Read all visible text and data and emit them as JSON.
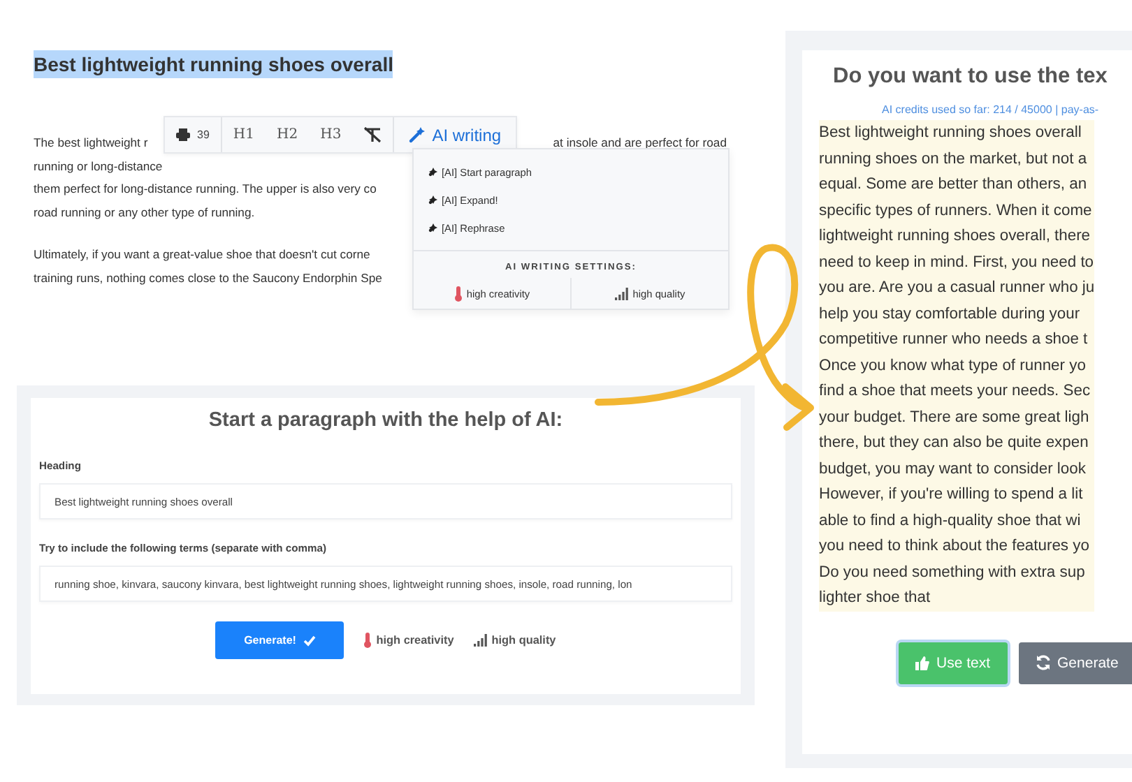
{
  "editor": {
    "heading": {
      "text": "Best lightweight running shoes overall",
      "selected": true
    },
    "paragraphs": [
      [
        {
          "left": "The best lightweight r",
          "right": "at insole and are perfect for road"
        },
        {
          "left": "running or long-distance"
        },
        {
          "left": "them perfect for long-distance running. The upper is also very co"
        },
        {
          "left": "road running or any other type of running."
        }
      ],
      [
        {
          "left": "Ultimately, if you want a great-value shoe that doesn't cut corne"
        },
        {
          "left": "training runs, nothing comes close to the Saucony Endorphin Spe"
        }
      ]
    ]
  },
  "toolbar": {
    "count": "39",
    "headings": [
      "H1",
      "H2",
      "H3"
    ],
    "ai_button": "AI writing"
  },
  "ai_menu": {
    "items": [
      "[AI] Start paragraph",
      "[AI] Expand!",
      "[AI] Rephrase"
    ],
    "settings_title": "AI WRITING SETTINGS:",
    "options": [
      {
        "label": "high creativity",
        "kind": "creativity"
      },
      {
        "label": "high quality",
        "kind": "quality"
      }
    ]
  },
  "dialog": {
    "title": "Start a paragraph with the help of AI:",
    "fields": [
      {
        "label": "Heading",
        "value": "Best lightweight running shoes overall"
      },
      {
        "label": "Try to include the following terms (separate with comma)",
        "value": "running shoe, kinvara, saucony kinvara, best lightweight running shoes, lightweight running shoes, insole, road running, lon"
      }
    ],
    "generate_button": "Generate!",
    "options": [
      {
        "label": "high creativity",
        "kind": "creativity"
      },
      {
        "label": "high quality",
        "kind": "quality"
      }
    ]
  },
  "result": {
    "title": "Do you want to use the tex",
    "credits": "AI credits used so far: 214 / 45000 | pay-as-",
    "lines": [
      "Best lightweight running shoes overall",
      "running shoes on the market, but not a",
      "equal. Some are better than others, an",
      "specific types of runners. When it come",
      "lightweight running shoes overall, there",
      "need to keep in mind. First, you need to",
      "you are. Are you a casual runner who ju",
      "help you stay comfortable during your",
      "competitive runner who needs a shoe t",
      "Once you know what type of runner yo",
      "find a shoe that meets your needs. Sec",
      "your budget. There are some great ligh",
      "there, but they can also be quite expen",
      "budget, you may want to consider look",
      "However, if you're willing to spend a lit",
      "able to find a high-quality shoe that wi",
      "you need to think about the features yo",
      "Do you need something with extra sup",
      "lighter shoe that"
    ],
    "buttons": [
      {
        "label": "Use text",
        "kind": "use"
      },
      {
        "label": "Generate",
        "kind": "regenerate"
      }
    ]
  }
}
